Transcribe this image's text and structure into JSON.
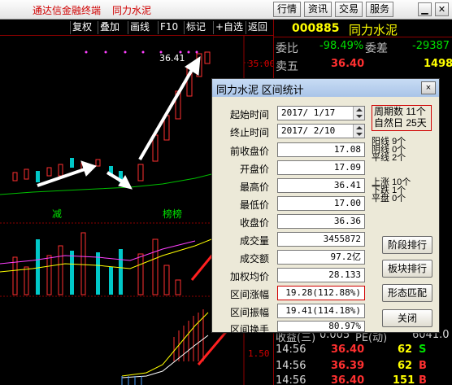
{
  "titlebar": {
    "app_name": "通达信金融终端",
    "stock_name": "同力水泥",
    "buttons": [
      "行情",
      "资讯",
      "交易",
      "服务"
    ]
  },
  "chart_toolbar": [
    "复权",
    "叠加",
    "画线",
    "F10",
    "标记",
    "+自选",
    "返回"
  ],
  "chart": {
    "peak_label": "36.41",
    "price_level": "35.00",
    "lower_level": "1.50",
    "tag_reduce": "减",
    "tag_list": "榜榜"
  },
  "quote": {
    "code": "000885",
    "name": "同力水泥",
    "rows": [
      {
        "label": "委比",
        "value": "-98.49%",
        "label2": "委差",
        "value2": "-29387"
      },
      {
        "label": "卖五",
        "price": "36.40",
        "vol": "1498"
      }
    ],
    "bottom_label": "收益(三)",
    "bottom_value": "0.005",
    "bottom_label2": "PE(动)",
    "bottom_value2": "6041.0",
    "ticks": [
      {
        "time": "14:56",
        "price": "36.40",
        "vol": "62",
        "dir": "S"
      },
      {
        "time": "14:56",
        "price": "36.39",
        "vol": "62",
        "dir": "B"
      },
      {
        "time": "14:56",
        "price": "36.40",
        "vol": "151",
        "dir": "B"
      }
    ]
  },
  "dialog": {
    "title": "同力水泥 区间统计",
    "close": "×",
    "fields": [
      {
        "label": "起始时间",
        "value": "2017/ 1/17"
      },
      {
        "label": "终止时间",
        "value": "2017/ 2/10"
      },
      {
        "label": "前收盘价",
        "value": "17.08"
      },
      {
        "label": "开盘价",
        "value": "17.09"
      },
      {
        "label": "最高价",
        "value": "36.41"
      },
      {
        "label": "最低价",
        "value": "17.00"
      },
      {
        "label": "收盘价",
        "value": "36.36"
      },
      {
        "label": "成交量",
        "value": "3455872"
      },
      {
        "label": "成交额",
        "value": "97.2亿"
      },
      {
        "label": "加权均价",
        "value": "28.133"
      },
      {
        "label": "区间涨幅",
        "value": "19.28(112.88%)"
      },
      {
        "label": "区间振幅",
        "value": "19.41(114.18%)"
      },
      {
        "label": "区间换手",
        "value": "80.97%"
      }
    ],
    "period_label": "周期数",
    "period_value": "11个",
    "natural_label": "自然日",
    "natural_value": "25天",
    "yang_label": "阳线",
    "yang_value": "9个",
    "yin_label": "阴线",
    "yin_value": "0个",
    "ping_label": "平线",
    "ping_value": "2个",
    "up_label": "上涨",
    "up_value": "10个",
    "down_label": "下跌",
    "down_value": "1个",
    "flat_label": "平盘",
    "flat_value": "0个",
    "buttons": [
      "阶段排行",
      "板块排行",
      "形态匹配",
      "关闭"
    ]
  }
}
